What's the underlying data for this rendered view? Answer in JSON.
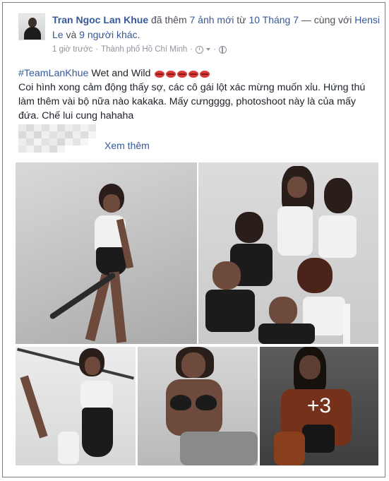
{
  "post": {
    "author": "Tran Ngoc Lan Khue",
    "action_prefix": "đã thêm",
    "action_count": "7 ảnh mới",
    "action_from": "từ",
    "action_date": "10 Tháng 7",
    "action_with": "— cùng với",
    "tagged_person": "Hensi Le",
    "tagged_and": "và",
    "tagged_others": "9 người khác",
    "tagged_suffix": ".",
    "time": "1 giờ trước",
    "separator": "·",
    "location": "Thành phố Hồ Chí Minh",
    "hashtag": "#TeamLanKhue",
    "caption_title": "Wet and Wild",
    "body": "Coi hình xong cảm động thấy sợ, các cô gái lột xác mừng muốn xỉu. Hứng thú làm thêm vài bộ nữa nào kakaka. Mấy cưngggg, photoshoot này là của mấy đứa. Chế lui cung hahaha",
    "see_more": "Xem thêm",
    "more_photos": "+3"
  },
  "colors": {
    "link": "#365899",
    "text": "#1d2129",
    "meta": "#90949c",
    "lips": "#d63a3a"
  }
}
